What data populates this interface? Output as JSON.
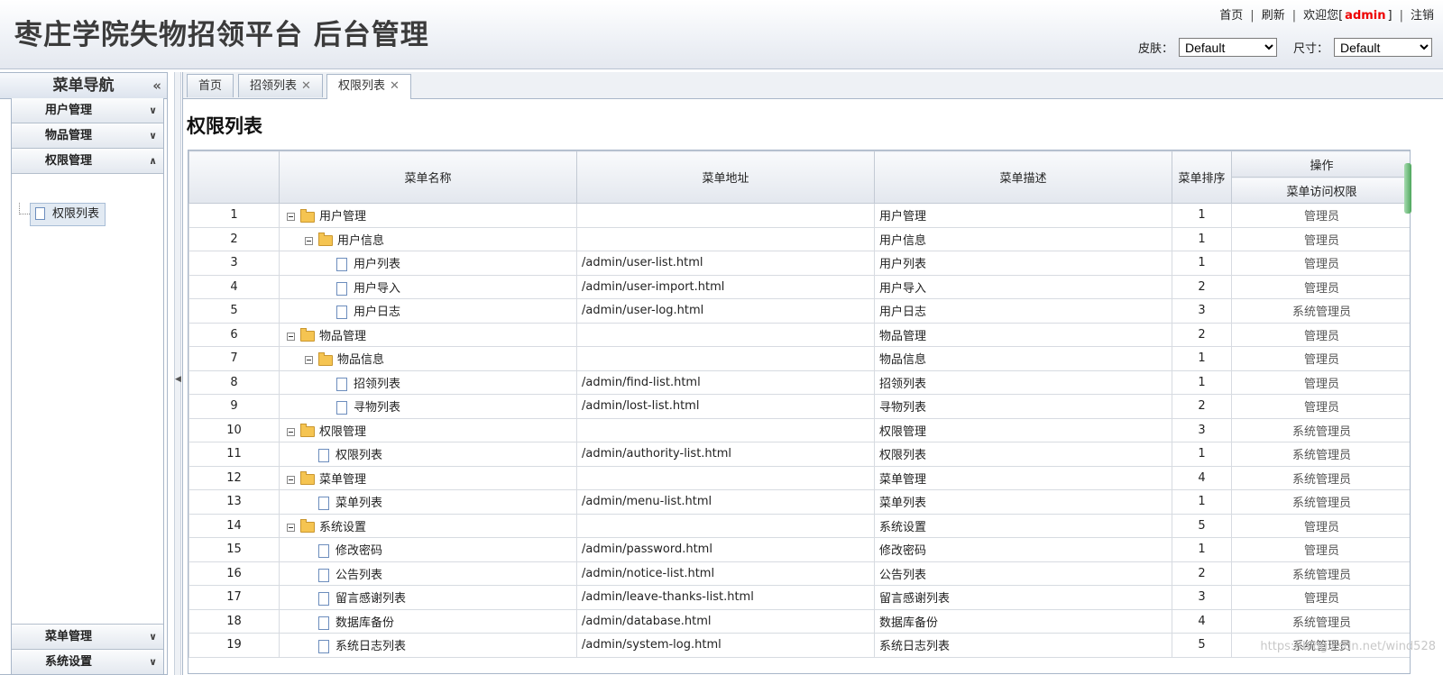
{
  "header": {
    "title": "枣庄学院失物招领平台 后台管理",
    "links": {
      "home": "首页",
      "refresh": "刷新",
      "welcome": "欢迎您[",
      "user": "admin",
      "close": "]",
      "logout": "注销"
    },
    "skin_label": "皮肤：",
    "skin_value": "Default",
    "size_label": "尺寸：",
    "size_value": "Default"
  },
  "sidebar": {
    "title": "菜单导航",
    "collapse_icon": "«",
    "items": [
      "用户管理",
      "物品管理",
      "权限管理",
      "菜单管理",
      "系统设置"
    ],
    "active_leaf": "权限列表"
  },
  "tabs": [
    {
      "label": "首页"
    },
    {
      "label": "招领列表"
    },
    {
      "label": "权限列表"
    }
  ],
  "page": {
    "title": "权限列表"
  },
  "grid": {
    "headers": {
      "name": "菜单名称",
      "url": "菜单地址",
      "desc": "菜单描述",
      "sort": "菜单排序",
      "ops": "操作",
      "access": "菜单访问权限"
    },
    "rows": [
      {
        "no": "1",
        "name": "用户管理",
        "level": 0,
        "type": "folder",
        "url": "",
        "desc": "用户管理",
        "sort": "1",
        "role": "管理员"
      },
      {
        "no": "2",
        "name": "用户信息",
        "level": 1,
        "type": "folder",
        "url": "",
        "desc": "用户信息",
        "sort": "1",
        "role": "管理员"
      },
      {
        "no": "3",
        "name": "用户列表",
        "level": 2,
        "type": "file",
        "url": "/admin/user-list.html",
        "desc": "用户列表",
        "sort": "1",
        "role": "管理员"
      },
      {
        "no": "4",
        "name": "用户导入",
        "level": 2,
        "type": "file",
        "url": "/admin/user-import.html",
        "desc": "用户导入",
        "sort": "2",
        "role": "管理员"
      },
      {
        "no": "5",
        "name": "用户日志",
        "level": 2,
        "type": "file",
        "url": "/admin/user-log.html",
        "desc": "用户日志",
        "sort": "3",
        "role": "系统管理员"
      },
      {
        "no": "6",
        "name": "物品管理",
        "level": 0,
        "type": "folder",
        "url": "",
        "desc": "物品管理",
        "sort": "2",
        "role": "管理员"
      },
      {
        "no": "7",
        "name": "物品信息",
        "level": 1,
        "type": "folder",
        "url": "",
        "desc": "物品信息",
        "sort": "1",
        "role": "管理员"
      },
      {
        "no": "8",
        "name": "招领列表",
        "level": 2,
        "type": "file",
        "url": "/admin/find-list.html",
        "desc": "招领列表",
        "sort": "1",
        "role": "管理员"
      },
      {
        "no": "9",
        "name": "寻物列表",
        "level": 2,
        "type": "file",
        "url": "/admin/lost-list.html",
        "desc": "寻物列表",
        "sort": "2",
        "role": "管理员"
      },
      {
        "no": "10",
        "name": "权限管理",
        "level": 0,
        "type": "folder",
        "url": "",
        "desc": "权限管理",
        "sort": "3",
        "role": "系统管理员"
      },
      {
        "no": "11",
        "name": "权限列表",
        "level": 1,
        "type": "file",
        "url": "/admin/authority-list.html",
        "desc": "权限列表",
        "sort": "1",
        "role": "系统管理员"
      },
      {
        "no": "12",
        "name": "菜单管理",
        "level": 0,
        "type": "folder",
        "url": "",
        "desc": "菜单管理",
        "sort": "4",
        "role": "系统管理员"
      },
      {
        "no": "13",
        "name": "菜单列表",
        "level": 1,
        "type": "file",
        "url": "/admin/menu-list.html",
        "desc": "菜单列表",
        "sort": "1",
        "role": "系统管理员"
      },
      {
        "no": "14",
        "name": "系统设置",
        "level": 0,
        "type": "folder",
        "url": "",
        "desc": "系统设置",
        "sort": "5",
        "role": "管理员"
      },
      {
        "no": "15",
        "name": "修改密码",
        "level": 1,
        "type": "file",
        "url": "/admin/password.html",
        "desc": "修改密码",
        "sort": "1",
        "role": "管理员"
      },
      {
        "no": "16",
        "name": "公告列表",
        "level": 1,
        "type": "file",
        "url": "/admin/notice-list.html",
        "desc": "公告列表",
        "sort": "2",
        "role": "系统管理员"
      },
      {
        "no": "17",
        "name": "留言感谢列表",
        "level": 1,
        "type": "file",
        "url": "/admin/leave-thanks-list.html",
        "desc": "留言感谢列表",
        "sort": "3",
        "role": "管理员"
      },
      {
        "no": "18",
        "name": "数据库备份",
        "level": 1,
        "type": "file",
        "url": "/admin/database.html",
        "desc": "数据库备份",
        "sort": "4",
        "role": "系统管理员"
      },
      {
        "no": "19",
        "name": "系统日志列表",
        "level": 1,
        "type": "file",
        "url": "/admin/system-log.html",
        "desc": "系统日志列表",
        "sort": "5",
        "role": "系统管理员"
      }
    ]
  },
  "watermark": "https://blog.csdn.net/wind528",
  "colors": {
    "accent": "#e00000",
    "header_bg": "#eef1f6",
    "border": "#a9b7c9"
  }
}
